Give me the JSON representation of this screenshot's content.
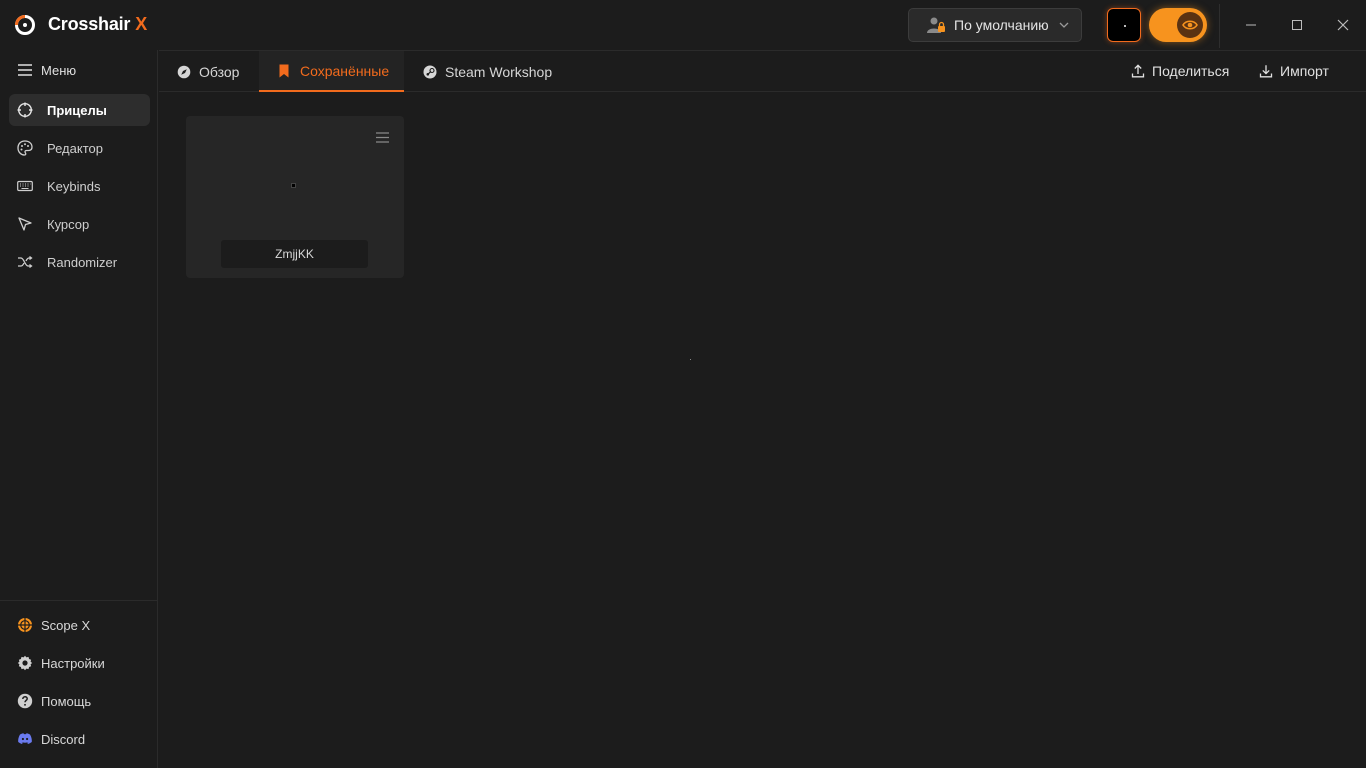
{
  "app": {
    "title": "Crosshair",
    "title_accent": "X"
  },
  "profile": {
    "selected": "По умолчанию"
  },
  "sidebar": {
    "menu_label": "Меню",
    "items": [
      {
        "label": "Прицелы",
        "icon": "crosshair-icon",
        "active": true
      },
      {
        "label": "Редактор",
        "icon": "palette-icon"
      },
      {
        "label": "Keybinds",
        "icon": "keyboard-icon"
      },
      {
        "label": "Курсор",
        "icon": "cursor-icon"
      },
      {
        "label": "Randomizer",
        "icon": "shuffle-icon"
      }
    ],
    "bottom": [
      {
        "label": "Scope X",
        "icon": "scope-icon"
      },
      {
        "label": "Настройки",
        "icon": "gear-icon"
      },
      {
        "label": "Помощь",
        "icon": "help-icon"
      },
      {
        "label": "Discord",
        "icon": "discord-icon"
      }
    ]
  },
  "tabs": [
    {
      "label": "Обзор",
      "icon": "compass-icon"
    },
    {
      "label": "Сохранённые",
      "icon": "bookmark-icon",
      "active": true
    },
    {
      "label": "Steam Workshop",
      "icon": "steam-icon"
    }
  ],
  "actions": {
    "share": "Поделиться",
    "import": "Импорт"
  },
  "saved": [
    {
      "name": "ZmjjKK"
    }
  ],
  "colors": {
    "accent": "#f26b1d",
    "toggle": "#f7931e",
    "background": "#1c1c1c",
    "card": "#262626"
  }
}
